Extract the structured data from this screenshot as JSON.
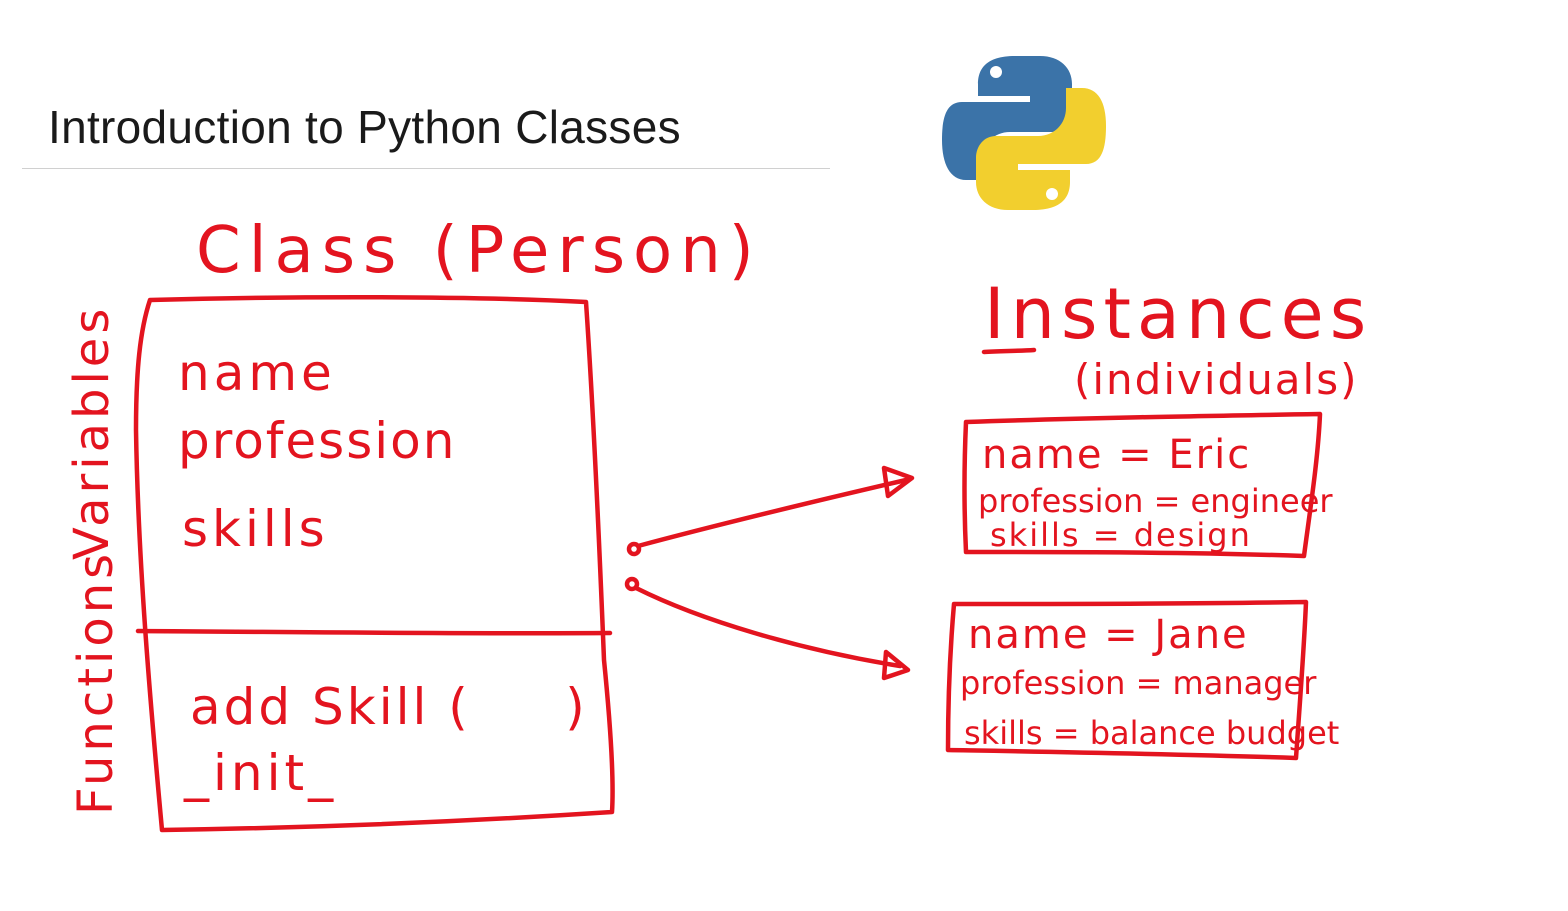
{
  "title": "Introduction to Python Classes",
  "colors": {
    "ink": "#e3141f",
    "python_blue": "#3b73a8",
    "python_yellow": "#f2cf2e"
  },
  "class_box": {
    "heading": "Class (Person)",
    "variables_label": "Variables",
    "functions_label": "Functions",
    "variables": [
      "name",
      "profession",
      "skills"
    ],
    "functions": [
      "add Skill (     )",
      "_init_"
    ]
  },
  "instances": {
    "heading": "Instances",
    "subheading": "(individuals)",
    "items": [
      {
        "name": "name = Eric",
        "profession": "profession = engineer",
        "skills": "skills = design"
      },
      {
        "name": "name = Jane",
        "profession": "profession = manager",
        "skills": "skills = balance budget"
      }
    ]
  },
  "logo_icon": "python-logo-icon"
}
